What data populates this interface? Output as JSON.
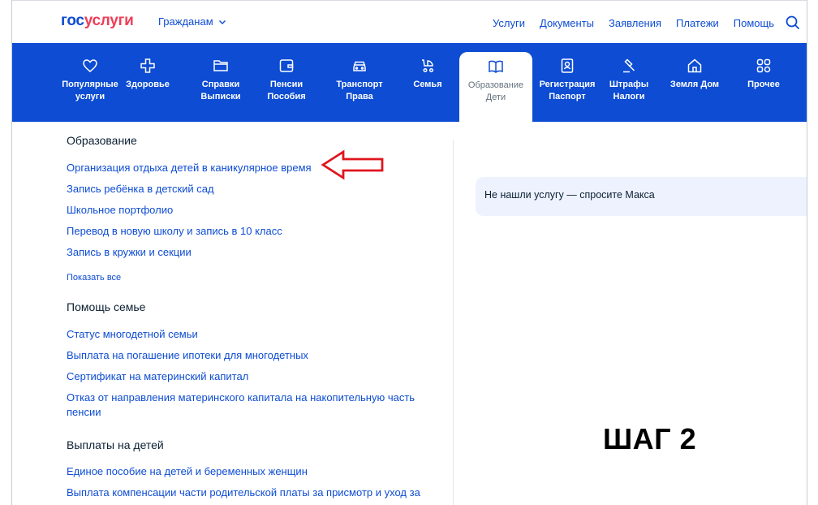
{
  "header": {
    "logo_gos": "гос",
    "logo_uslugi": "услуги",
    "audience": "Гражданам",
    "nav": [
      "Услуги",
      "Документы",
      "Заявления",
      "Платежи",
      "Помощь"
    ]
  },
  "categories": [
    {
      "label": "Популярные\nуслуги",
      "icon": "heart-icon"
    },
    {
      "label": "Здоровье",
      "icon": "medical-cross-icon"
    },
    {
      "label": "Справки\nВыписки",
      "icon": "folder-icon"
    },
    {
      "label": "Пенсии\nПособия",
      "icon": "wallet-icon"
    },
    {
      "label": "Транспорт\nПрава",
      "icon": "car-icon"
    },
    {
      "label": "Семья",
      "icon": "stroller-icon"
    },
    {
      "label": "Образование\nДети",
      "icon": "book-icon",
      "active": true
    },
    {
      "label": "Регистрация\nПаспорт",
      "icon": "passport-icon"
    },
    {
      "label": "Штрафы\nНалоги",
      "icon": "gavel-icon"
    },
    {
      "label": "Земля Дом",
      "icon": "house-icon"
    },
    {
      "label": "Прочее",
      "icon": "grid-icon"
    }
  ],
  "sections": [
    {
      "title": "Образование",
      "links": [
        "Организация отдыха детей в каникулярное время",
        "Запись ребёнка в детский сад",
        "Школьное портфолио",
        "Перевод в новую школу и запись в 10 класс",
        "Запись в кружки и секции"
      ],
      "show_all": "Показать все"
    },
    {
      "title": "Помощь семье",
      "links": [
        "Статус многодетной семьи",
        "Выплата на погашение ипотеки для многодетных",
        "Сертификат на материнский капитал",
        "Отказ от направления материнского капитала на накопительную часть",
        "пенсии"
      ]
    },
    {
      "title": "Выплаты на детей",
      "links": [
        "Единое пособие на детей и беременных женщин",
        "Выплата компенсации части родительской платы за присмотр и уход за"
      ]
    }
  ],
  "ask_max": "Не нашли услугу — спросите Макса",
  "step_label": "ШАГ 2",
  "colors": {
    "brand_blue": "#0d4cd3",
    "brand_red": "#ee3f58",
    "annotation_arrow": "#e0161e",
    "ask_bg": "#edf2fe"
  }
}
